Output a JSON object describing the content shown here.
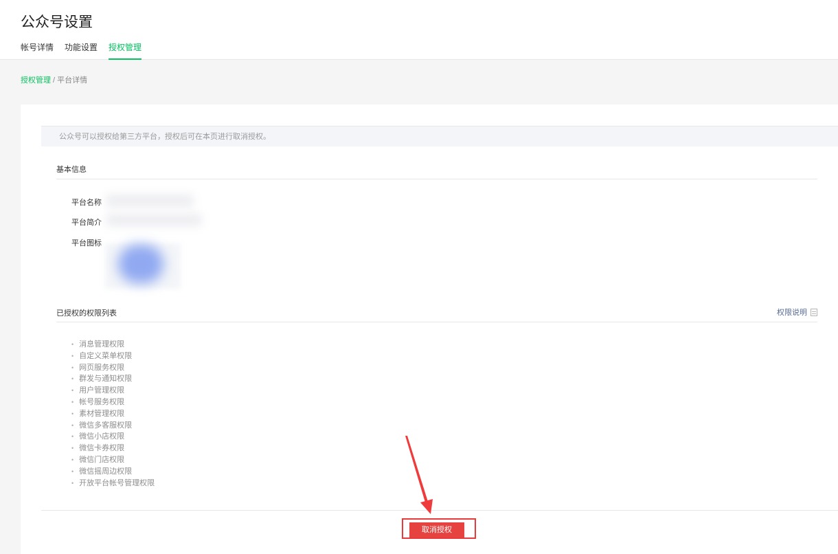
{
  "page": {
    "title": "公众号设置"
  },
  "tabs": [
    {
      "label": "帐号详情",
      "active": false
    },
    {
      "label": "功能设置",
      "active": false
    },
    {
      "label": "授权管理",
      "active": true
    }
  ],
  "breadcrumb": {
    "link": "授权管理",
    "separator": " / ",
    "current": "平台详情"
  },
  "notice": "公众号可以授权给第三方平台，授权后可在本页进行取消授权。",
  "basic_info": {
    "title": "基本信息",
    "labels": {
      "name": "平台名称",
      "intro": "平台简介",
      "icon": "平台图标"
    }
  },
  "permissions": {
    "title": "已授权的权限列表",
    "doc_link": "权限说明",
    "items": [
      "消息管理权限",
      "自定义菜单权限",
      "网页服务权限",
      "群发与通知权限",
      "用户管理权限",
      "帐号服务权限",
      "素材管理权限",
      "微信多客服权限",
      "微信小店权限",
      "微信卡券权限",
      "微信门店权限",
      "微信摇周边权限",
      "开放平台帐号管理权限"
    ]
  },
  "actions": {
    "cancel_auth": "取消授权"
  },
  "colors": {
    "accent": "#07c160",
    "danger": "#e64340",
    "link": "#576b95",
    "annotation": "#ef3b3b"
  }
}
